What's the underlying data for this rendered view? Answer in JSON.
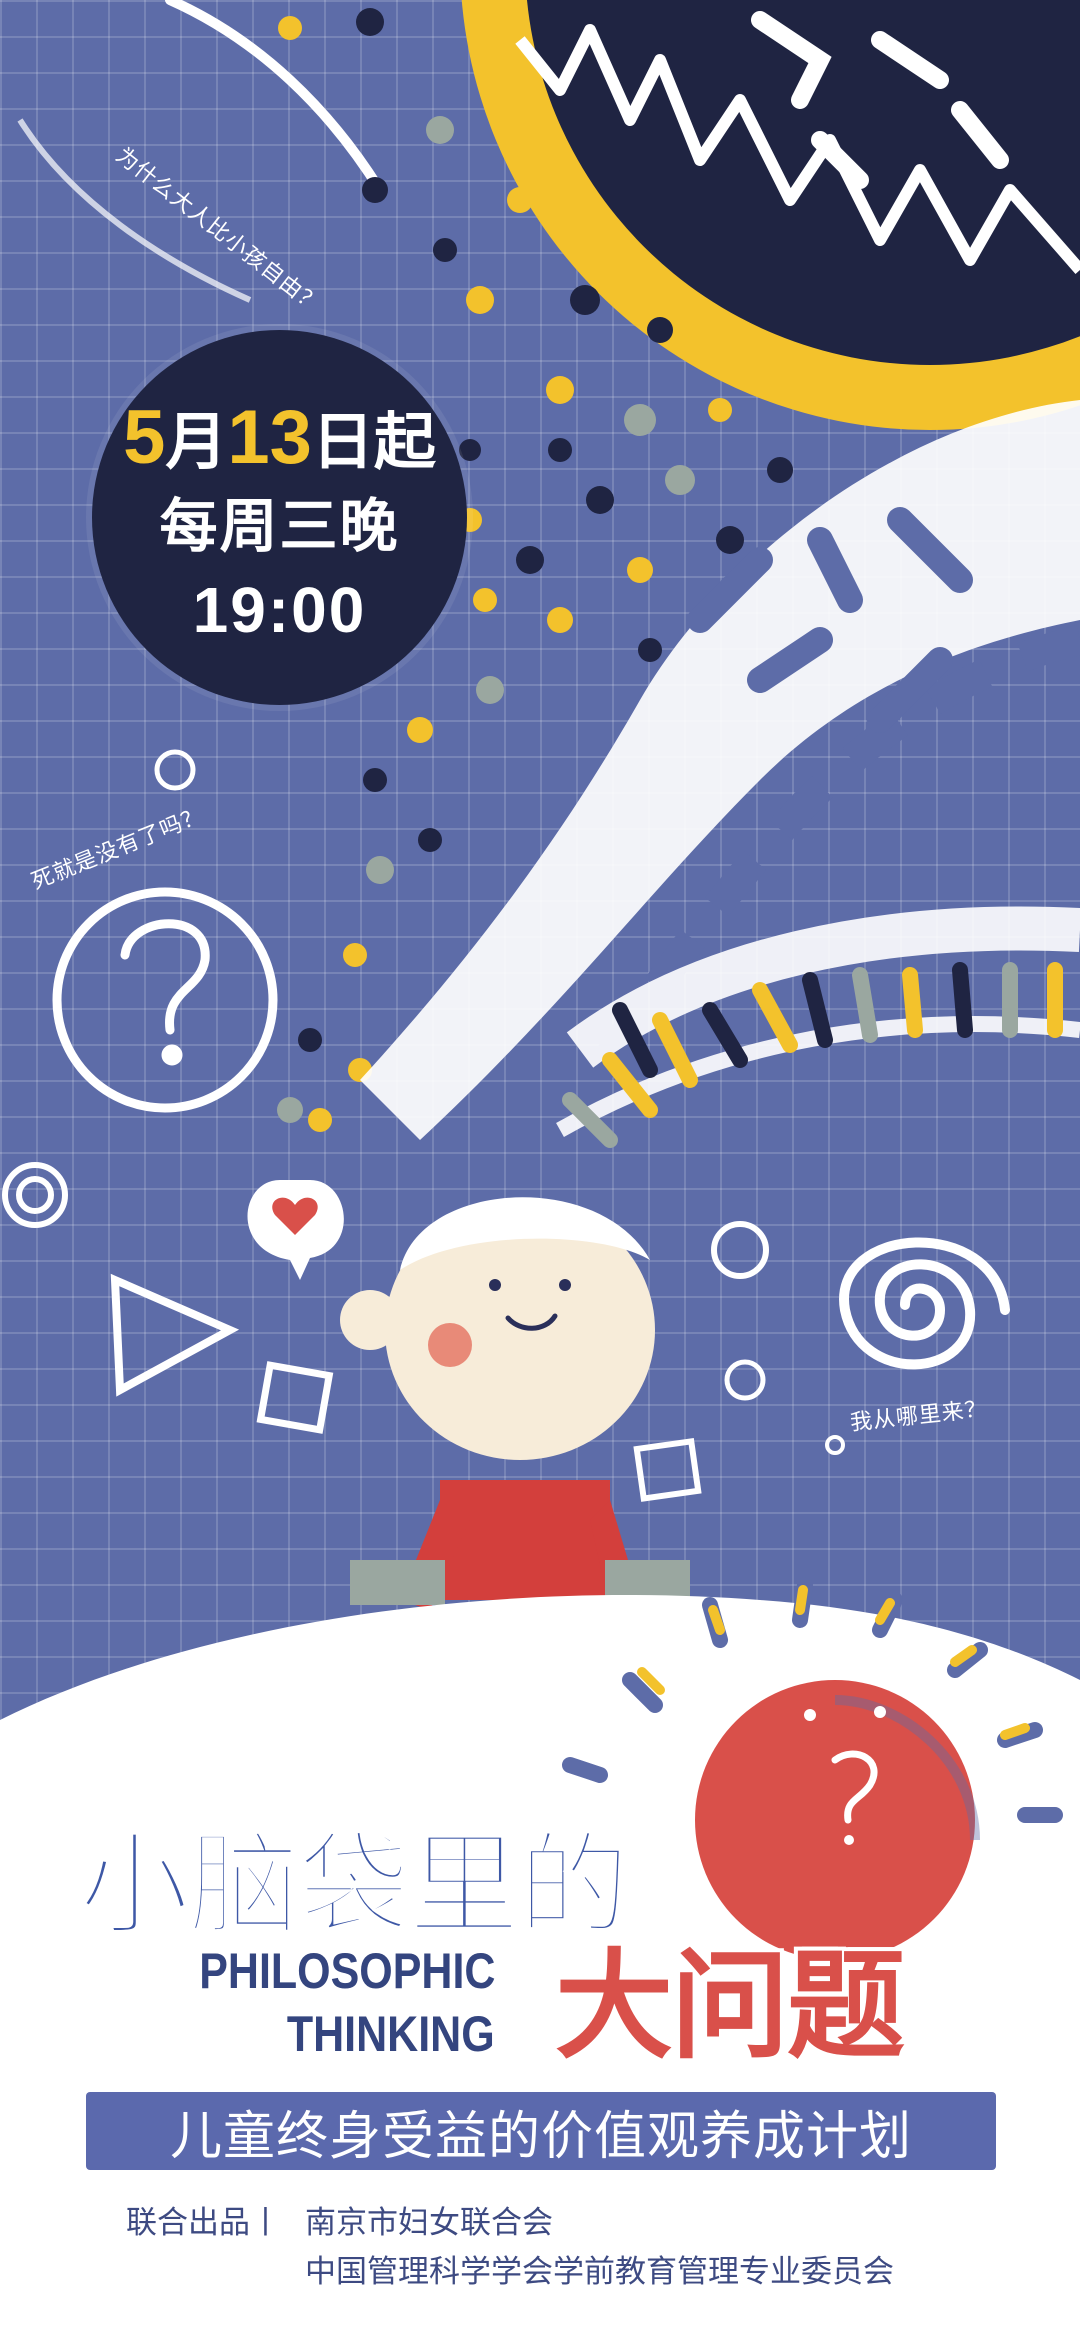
{
  "date_badge": {
    "line1_num1": "5",
    "line1_mid": "月",
    "line1_num2": "13",
    "line1_end": "日起",
    "line2": "每周三晚",
    "line3": "19:00"
  },
  "thought_notes": {
    "top": "为什么大人比小孩自由？",
    "left": "死就是没有了吗？",
    "right": "我从哪里来？"
  },
  "title": {
    "chinese_main": "小脑袋里的",
    "chinese_big": "大问题",
    "english_line1": "PHILOSOPHIC",
    "english_line2": "THINKING"
  },
  "subtitle": "儿童终身受益的价值观养成计划",
  "organizers": {
    "label": "联合出品丨",
    "org1": "南京市妇女联合会",
    "org2": "中国管理科学学会学前教育管理专业委员会"
  },
  "colors": {
    "background": "#5d6ca8",
    "navy": "#1f2442",
    "yellow": "#f3c22c",
    "red": "#d9504a",
    "title_blue": "#3e58a6"
  }
}
